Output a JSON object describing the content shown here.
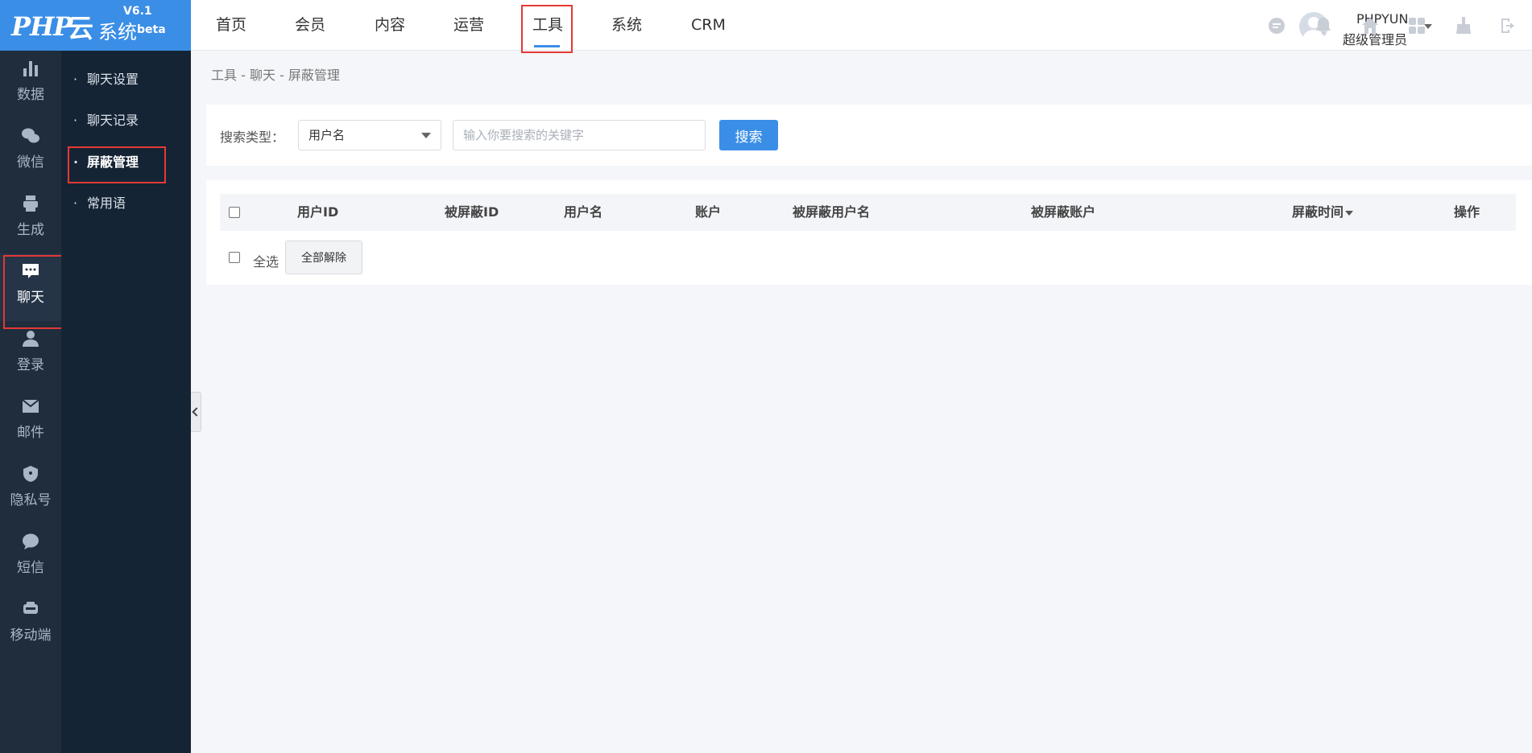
{
  "logo": {
    "php": "PHP",
    "yun": "云",
    "system": "系统",
    "version": "V6.1",
    "beta": "beta"
  },
  "iconbar": [
    {
      "label": "数据",
      "icon": "bar-chart-icon"
    },
    {
      "label": "微信",
      "icon": "wechat-icon"
    },
    {
      "label": "生成",
      "icon": "printer-icon"
    },
    {
      "label": "聊天",
      "icon": "chat-bubble-icon",
      "active": true
    },
    {
      "label": "登录",
      "icon": "user-icon"
    },
    {
      "label": "邮件",
      "icon": "envelope-icon"
    },
    {
      "label": "隐私号",
      "icon": "shield-icon"
    },
    {
      "label": "短信",
      "icon": "message-icon"
    },
    {
      "label": "移动端",
      "icon": "app-icon"
    }
  ],
  "submenu": [
    {
      "label": "聊天设置"
    },
    {
      "label": "聊天记录"
    },
    {
      "label": "屏蔽管理",
      "active": true
    },
    {
      "label": "常用语"
    }
  ],
  "topnav": [
    {
      "label": "首页"
    },
    {
      "label": "会员"
    },
    {
      "label": "内容"
    },
    {
      "label": "运营"
    },
    {
      "label": "工具",
      "active": true
    },
    {
      "label": "系统"
    },
    {
      "label": "CRM"
    }
  ],
  "user": {
    "name": "PHPYUN",
    "role": "超级管理员"
  },
  "header_icons": [
    "message-icon",
    "bell-icon",
    "home-icon",
    "grid-icon",
    "broom-icon",
    "logout-icon"
  ],
  "breadcrumb": "工具 - 聊天 - 屏蔽管理",
  "search": {
    "label": "搜索类型：",
    "type_value": "用户名",
    "placeholder": "输入你要搜索的关键字",
    "button": "搜索"
  },
  "table": {
    "columns": [
      "用户ID",
      "被屏蔽ID",
      "用户名",
      "账户",
      "被屏蔽用户名",
      "被屏蔽账户",
      "屏蔽时间",
      "操作"
    ],
    "select_all": "全选",
    "unblock_all": "全部解除"
  },
  "colors": {
    "accent": "#3a8ee6",
    "sidebar": "#1f2d3d",
    "submenu": "#152434",
    "highlight": "#e53935"
  }
}
